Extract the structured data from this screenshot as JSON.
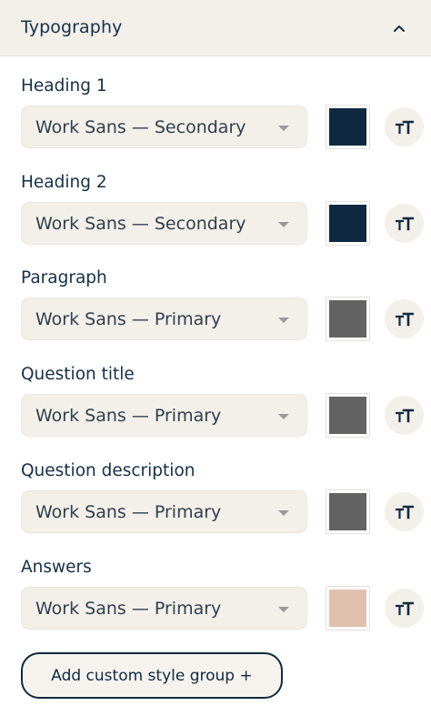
{
  "panel": {
    "title": "Typography",
    "collapse_icon": "chevron-up-icon"
  },
  "rows": [
    {
      "label": "Heading 1",
      "font": "Work Sans — Secondary",
      "color": "#0f2a40",
      "swatch_border": "#dcdcdc"
    },
    {
      "label": "Heading 2",
      "font": "Work Sans — Secondary",
      "color": "#0f2a40",
      "swatch_border": "#dcdcdc"
    },
    {
      "label": "Paragraph",
      "font": "Work Sans — Primary",
      "color": "#636363",
      "swatch_border": "#dcdcdc"
    },
    {
      "label": "Question title",
      "font": "Work Sans — Primary",
      "color": "#636363",
      "swatch_border": "#dcdcdc"
    },
    {
      "label": "Question description",
      "font": "Work Sans — Primary",
      "color": "#636363",
      "swatch_border": "#dcdcdc"
    },
    {
      "label": "Answers",
      "font": "Work Sans — Primary",
      "color": "#e0c1ae",
      "swatch_border": "#dcdcdc"
    }
  ],
  "icons": {
    "dropdown": "caret-down-icon",
    "text_size": "text-size-icon"
  },
  "add_button": {
    "label": "Add custom style group +"
  }
}
